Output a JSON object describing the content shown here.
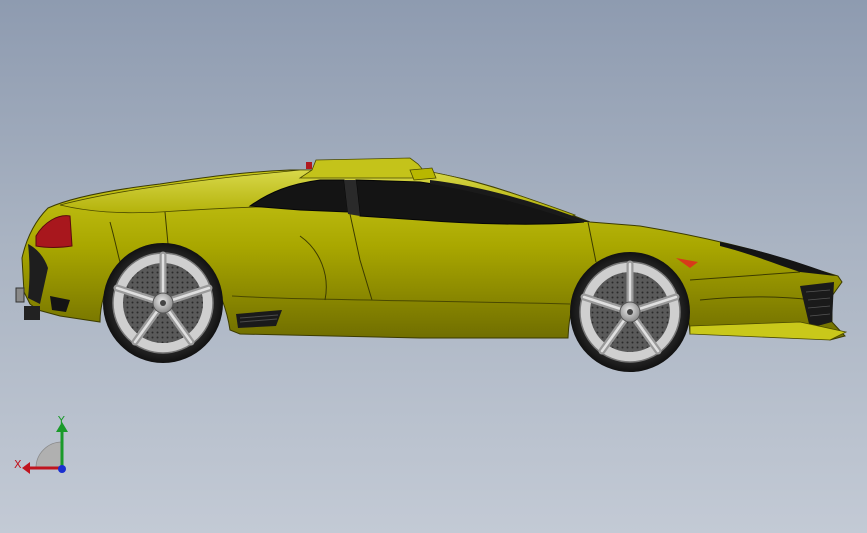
{
  "viewport": {
    "background_top": "#8e9bb0",
    "background_bottom": "#c3cad5"
  },
  "model": {
    "body_color": "#b3b200",
    "shadow_color": "#6e6c00",
    "glass_color": "#121212",
    "taillight_color": "#b0191f"
  },
  "triad": {
    "y_label": "Y",
    "x_label": "X",
    "y_color": "#1a9a2a",
    "x_color": "#c0141e",
    "z_color": "#1a2fd0"
  }
}
